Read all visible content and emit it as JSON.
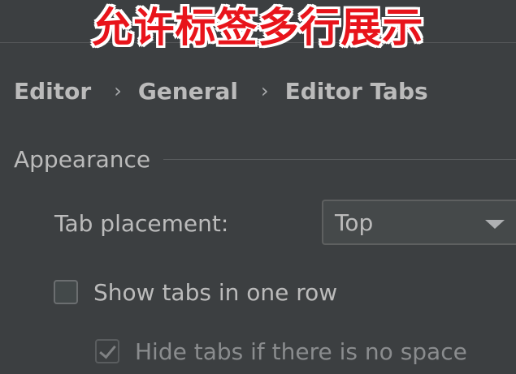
{
  "overlay": {
    "title": "允许标签多行展示"
  },
  "breadcrumb": {
    "items": [
      "Editor",
      "General",
      "Editor Tabs"
    ],
    "separator": "›"
  },
  "section": {
    "title": "Appearance"
  },
  "tab_placement": {
    "label": "Tab placement:",
    "selected": "Top",
    "icon": "chevron-down-icon"
  },
  "options": {
    "show_tabs_one_row": {
      "label": "Show tabs in one row",
      "checked": false,
      "enabled": true
    },
    "hide_tabs_no_space": {
      "label": "Hide tabs if there is no space",
      "checked": true,
      "enabled": false
    }
  },
  "colors": {
    "background": "#3c3f41",
    "text": "#bbbbbb",
    "overlay_text": "#e8141b",
    "overlay_outline": "#ffffff"
  }
}
